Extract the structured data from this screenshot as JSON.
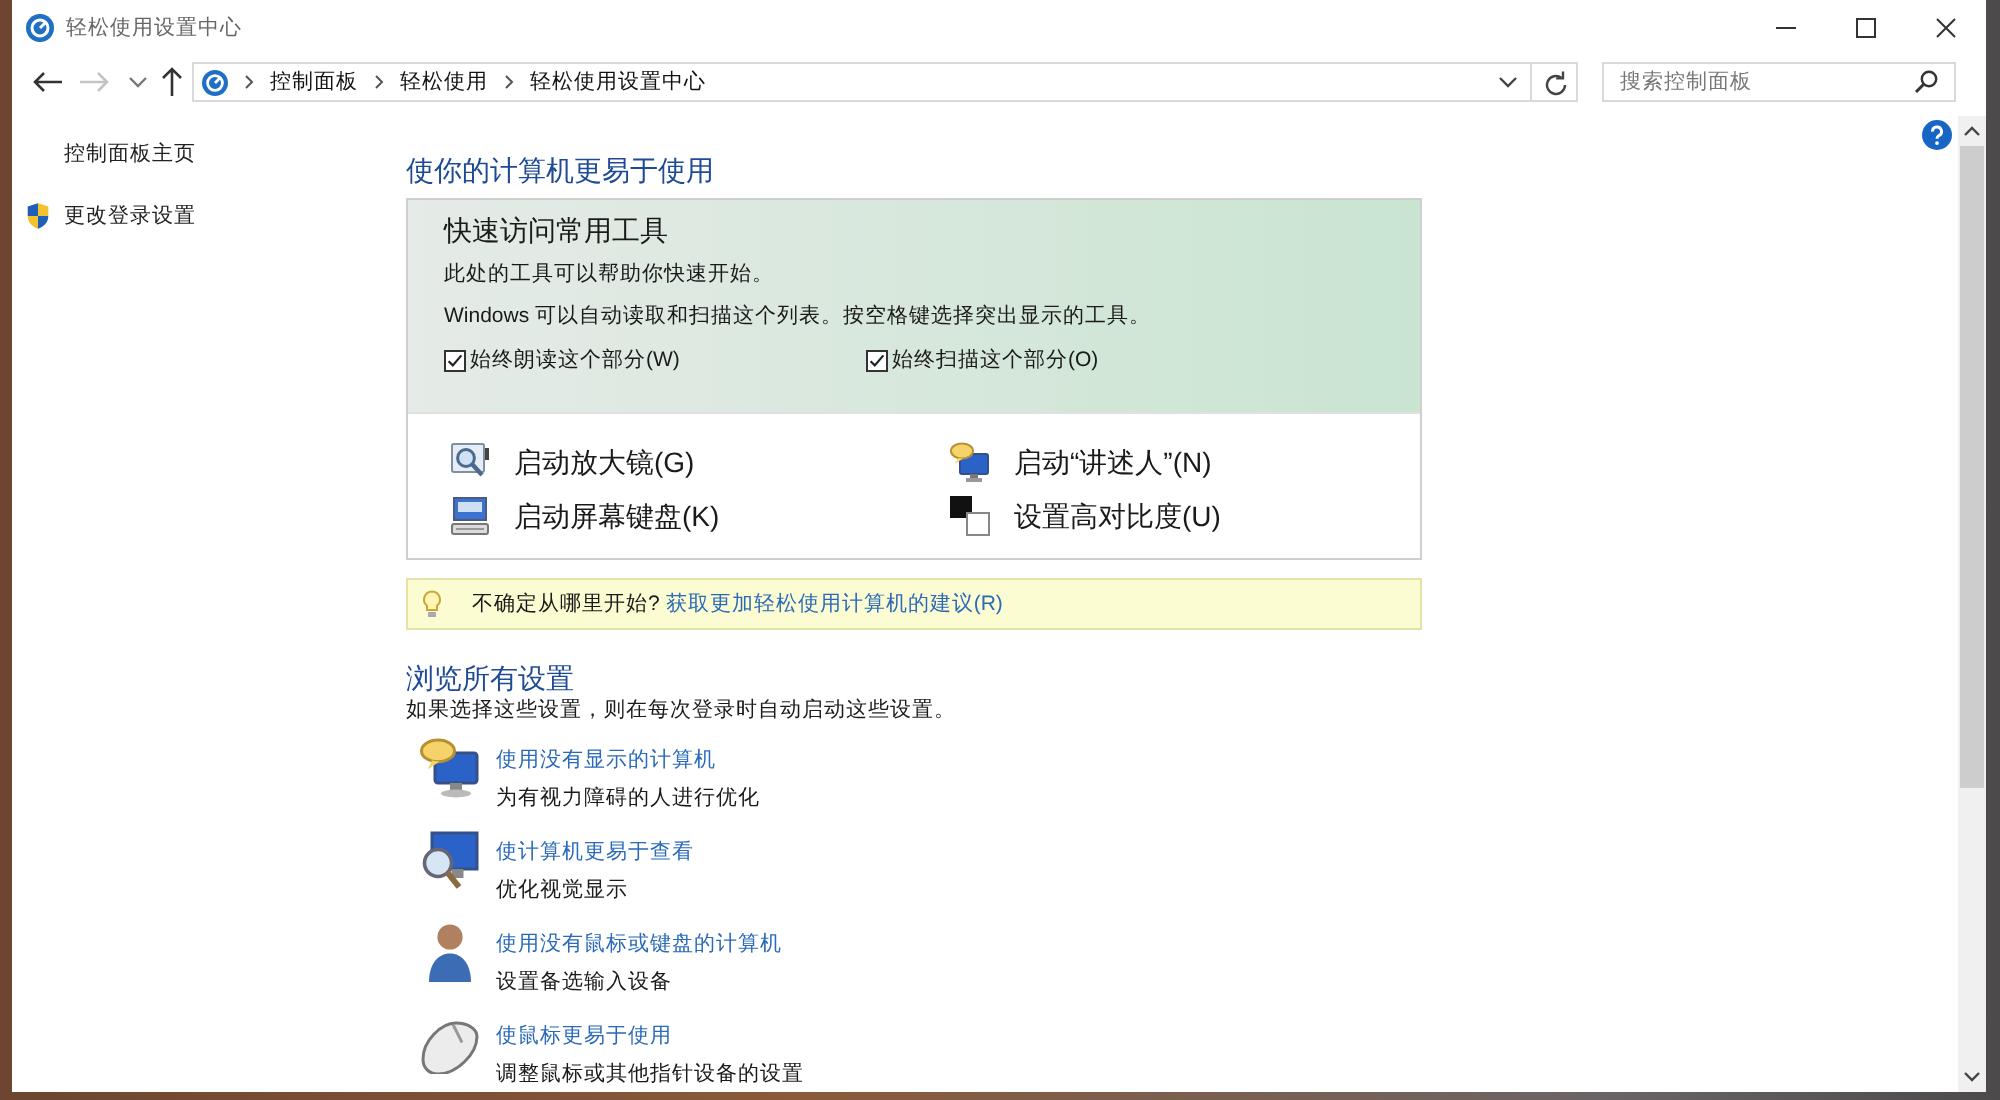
{
  "window": {
    "title": "轻松使用设置中心"
  },
  "toolbar": {
    "navigation": [
      {
        "kind": "back",
        "disabled": false
      },
      {
        "kind": "forward",
        "disabled": true
      },
      {
        "kind": "recent",
        "disabled": false
      },
      {
        "kind": "up",
        "disabled": false
      }
    ],
    "breadcrumbs": [
      "控制面板",
      "轻松使用",
      "轻松使用设置中心"
    ],
    "search": {
      "placeholder": "搜索控制面板"
    }
  },
  "sidebar": {
    "items": [
      {
        "label": "控制面板主页",
        "kind": "link"
      },
      {
        "label": "更改登录设置",
        "kind": "shield"
      }
    ]
  },
  "quick_access": {
    "heading": "使你的计算机更易于使用",
    "title": "快速访问常用工具",
    "lines": [
      "此处的工具可以帮助你快速开始。",
      "Windows 可以自动读取和扫描这个列表。按空格键选择突出显示的工具。"
    ],
    "checkboxes": [
      {
        "label": "始终朗读这个部分(W)",
        "checked": true
      },
      {
        "label": "始终扫描这个部分(O)",
        "checked": true
      }
    ],
    "tools": [
      {
        "label": "启动放大镜(G)",
        "kind": "magnifier"
      },
      {
        "label": "启动“讲述人”(N)",
        "kind": "narrator"
      },
      {
        "label": "启动屏幕键盘(K)",
        "kind": "keyboard"
      },
      {
        "label": "设置高对比度(U)",
        "kind": "contrast"
      }
    ]
  },
  "tip": {
    "text": "不确定从哪里开始?",
    "link": "获取更加轻松使用计算机的建议(R)"
  },
  "browse": {
    "title": "浏览所有设置",
    "subtitle": "如果选择这些设置，则在每次登录时自动启动这些设置。",
    "items": [
      {
        "title": "使用没有显示的计算机",
        "description": "为有视力障碍的人进行优化",
        "kind": "no-display"
      },
      {
        "title": "使计算机更易于查看",
        "description": "优化视觉显示",
        "kind": "easier-to-see"
      },
      {
        "title": "使用没有鼠标或键盘的计算机",
        "description": "设置备选输入设备",
        "kind": "no-mouse"
      },
      {
        "title": "使鼠标更易于使用",
        "description": "调整鼠标或其他指针设备的设置",
        "kind": "mouse"
      }
    ]
  }
}
